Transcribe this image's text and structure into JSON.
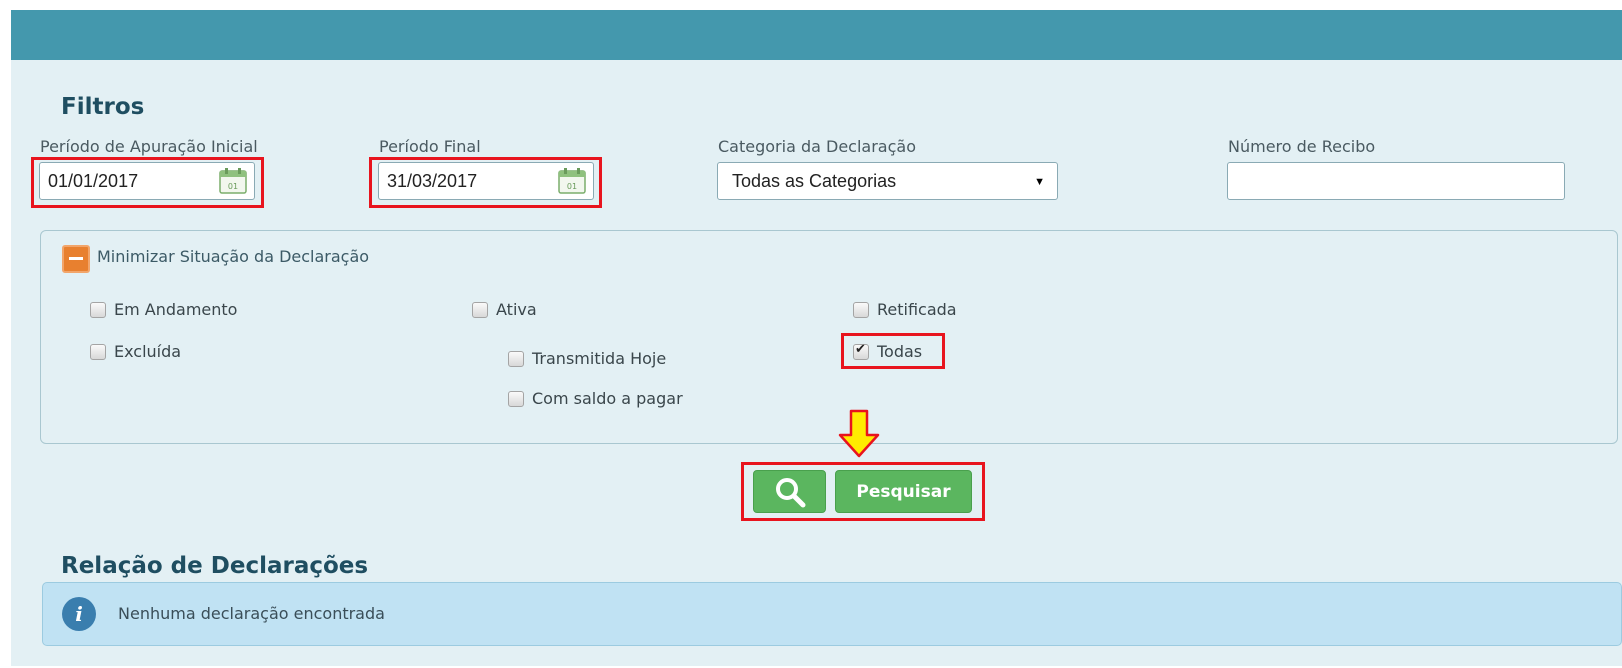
{
  "filters": {
    "title": "Filtros",
    "periodo_inicial": {
      "label": "Período de Apuração Inicial",
      "value": "01/01/2017"
    },
    "periodo_final": {
      "label": "Período Final",
      "value": "31/03/2017"
    },
    "categoria": {
      "label": "Categoria da Declaração",
      "selected": "Todas as Categorias"
    },
    "numero_recibo": {
      "label": "Número de Recibo",
      "value": ""
    },
    "calendar_icon_text": "01"
  },
  "situacao": {
    "toggle_label": "Minimizar Situação da Declaração",
    "options": [
      {
        "label": "Em Andamento",
        "checked": false
      },
      {
        "label": "Ativa",
        "checked": false
      },
      {
        "label": "Retificada",
        "checked": false
      },
      {
        "label": "Excluída",
        "checked": false
      },
      {
        "label": "Transmitida Hoje",
        "checked": false
      },
      {
        "label": "Todas",
        "checked": true
      },
      {
        "label": "Com saldo a pagar",
        "checked": false
      }
    ]
  },
  "actions": {
    "search_label": "Pesquisar"
  },
  "results": {
    "title": "Relação de Declarações",
    "empty_message": "Nenhuma declaração encontrada"
  },
  "icons": {
    "calendar": "calendar-icon",
    "search": "search-icon",
    "info": "info-icon",
    "arrow": "arrow-down-icon",
    "collapse": "minus-icon"
  },
  "colors": {
    "header": "#4498ad",
    "panel": "#e3f0f4",
    "title": "#1f4e61",
    "highlight": "#e8141e",
    "button": "#5bb65f",
    "toggle": "#e8802f",
    "info_bar": "#c0e2f3",
    "arrow": "#ffec00"
  }
}
